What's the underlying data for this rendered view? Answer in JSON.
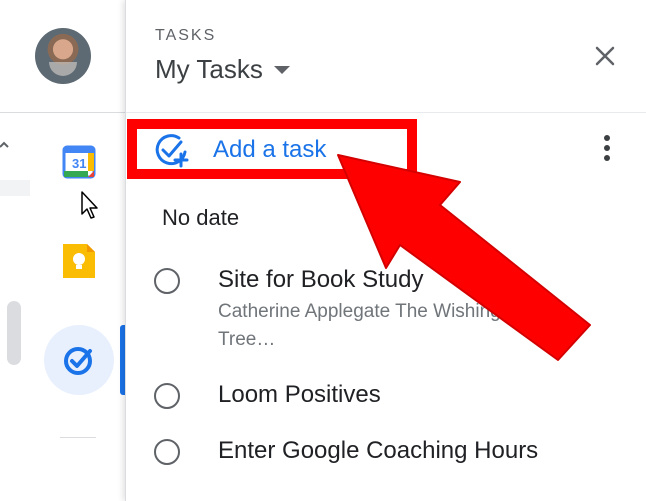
{
  "panel": {
    "label": "TASKS",
    "list_title": "My Tasks"
  },
  "actions": {
    "add_task_label": "Add a task"
  },
  "section": {
    "label": "No date"
  },
  "tasks": [
    {
      "title": "Site for Book Study",
      "notes": "Catherine Applegate The Wishing Tree…"
    },
    {
      "title": "Loom Positives"
    },
    {
      "title": "Enter Google Coaching Hours"
    }
  ],
  "colors": {
    "accent": "#1a73e8",
    "annotation": "#ff0000",
    "active_bg": "#e8f0fe"
  },
  "icons": [
    "calendar-icon",
    "keep-icon",
    "tasks-icon",
    "add-task-icon",
    "more-vert-icon",
    "close-icon",
    "dropdown-arrow-icon",
    "mouse-cursor-icon"
  ]
}
